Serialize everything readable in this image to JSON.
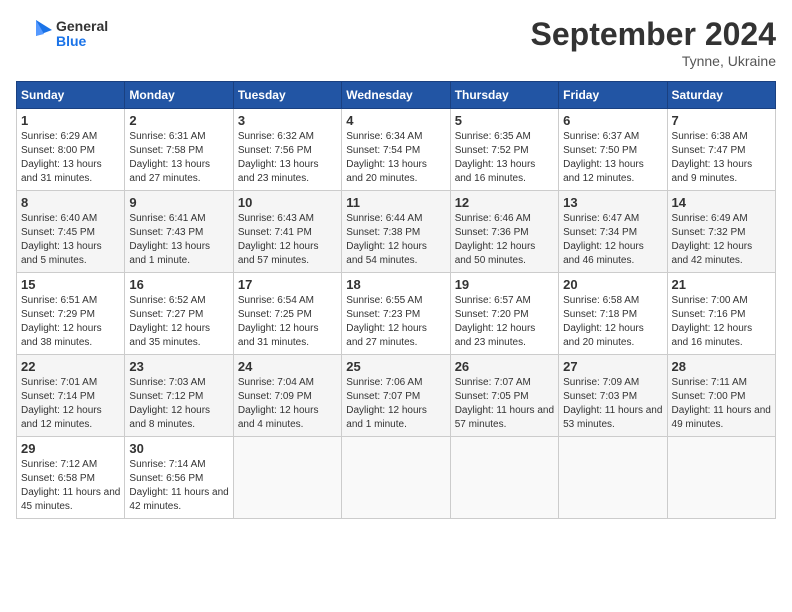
{
  "header": {
    "logo_line1": "General",
    "logo_line2": "Blue",
    "month_title": "September 2024",
    "location": "Tynne, Ukraine"
  },
  "weekdays": [
    "Sunday",
    "Monday",
    "Tuesday",
    "Wednesday",
    "Thursday",
    "Friday",
    "Saturday"
  ],
  "weeks": [
    [
      {
        "day": "1",
        "info": "Sunrise: 6:29 AM\nSunset: 8:00 PM\nDaylight: 13 hours and 31 minutes."
      },
      {
        "day": "2",
        "info": "Sunrise: 6:31 AM\nSunset: 7:58 PM\nDaylight: 13 hours and 27 minutes."
      },
      {
        "day": "3",
        "info": "Sunrise: 6:32 AM\nSunset: 7:56 PM\nDaylight: 13 hours and 23 minutes."
      },
      {
        "day": "4",
        "info": "Sunrise: 6:34 AM\nSunset: 7:54 PM\nDaylight: 13 hours and 20 minutes."
      },
      {
        "day": "5",
        "info": "Sunrise: 6:35 AM\nSunset: 7:52 PM\nDaylight: 13 hours and 16 minutes."
      },
      {
        "day": "6",
        "info": "Sunrise: 6:37 AM\nSunset: 7:50 PM\nDaylight: 13 hours and 12 minutes."
      },
      {
        "day": "7",
        "info": "Sunrise: 6:38 AM\nSunset: 7:47 PM\nDaylight: 13 hours and 9 minutes."
      }
    ],
    [
      {
        "day": "8",
        "info": "Sunrise: 6:40 AM\nSunset: 7:45 PM\nDaylight: 13 hours and 5 minutes."
      },
      {
        "day": "9",
        "info": "Sunrise: 6:41 AM\nSunset: 7:43 PM\nDaylight: 13 hours and 1 minute."
      },
      {
        "day": "10",
        "info": "Sunrise: 6:43 AM\nSunset: 7:41 PM\nDaylight: 12 hours and 57 minutes."
      },
      {
        "day": "11",
        "info": "Sunrise: 6:44 AM\nSunset: 7:38 PM\nDaylight: 12 hours and 54 minutes."
      },
      {
        "day": "12",
        "info": "Sunrise: 6:46 AM\nSunset: 7:36 PM\nDaylight: 12 hours and 50 minutes."
      },
      {
        "day": "13",
        "info": "Sunrise: 6:47 AM\nSunset: 7:34 PM\nDaylight: 12 hours and 46 minutes."
      },
      {
        "day": "14",
        "info": "Sunrise: 6:49 AM\nSunset: 7:32 PM\nDaylight: 12 hours and 42 minutes."
      }
    ],
    [
      {
        "day": "15",
        "info": "Sunrise: 6:51 AM\nSunset: 7:29 PM\nDaylight: 12 hours and 38 minutes."
      },
      {
        "day": "16",
        "info": "Sunrise: 6:52 AM\nSunset: 7:27 PM\nDaylight: 12 hours and 35 minutes."
      },
      {
        "day": "17",
        "info": "Sunrise: 6:54 AM\nSunset: 7:25 PM\nDaylight: 12 hours and 31 minutes."
      },
      {
        "day": "18",
        "info": "Sunrise: 6:55 AM\nSunset: 7:23 PM\nDaylight: 12 hours and 27 minutes."
      },
      {
        "day": "19",
        "info": "Sunrise: 6:57 AM\nSunset: 7:20 PM\nDaylight: 12 hours and 23 minutes."
      },
      {
        "day": "20",
        "info": "Sunrise: 6:58 AM\nSunset: 7:18 PM\nDaylight: 12 hours and 20 minutes."
      },
      {
        "day": "21",
        "info": "Sunrise: 7:00 AM\nSunset: 7:16 PM\nDaylight: 12 hours and 16 minutes."
      }
    ],
    [
      {
        "day": "22",
        "info": "Sunrise: 7:01 AM\nSunset: 7:14 PM\nDaylight: 12 hours and 12 minutes."
      },
      {
        "day": "23",
        "info": "Sunrise: 7:03 AM\nSunset: 7:12 PM\nDaylight: 12 hours and 8 minutes."
      },
      {
        "day": "24",
        "info": "Sunrise: 7:04 AM\nSunset: 7:09 PM\nDaylight: 12 hours and 4 minutes."
      },
      {
        "day": "25",
        "info": "Sunrise: 7:06 AM\nSunset: 7:07 PM\nDaylight: 12 hours and 1 minute."
      },
      {
        "day": "26",
        "info": "Sunrise: 7:07 AM\nSunset: 7:05 PM\nDaylight: 11 hours and 57 minutes."
      },
      {
        "day": "27",
        "info": "Sunrise: 7:09 AM\nSunset: 7:03 PM\nDaylight: 11 hours and 53 minutes."
      },
      {
        "day": "28",
        "info": "Sunrise: 7:11 AM\nSunset: 7:00 PM\nDaylight: 11 hours and 49 minutes."
      }
    ],
    [
      {
        "day": "29",
        "info": "Sunrise: 7:12 AM\nSunset: 6:58 PM\nDaylight: 11 hours and 45 minutes."
      },
      {
        "day": "30",
        "info": "Sunrise: 7:14 AM\nSunset: 6:56 PM\nDaylight: 11 hours and 42 minutes."
      },
      {
        "day": "",
        "info": ""
      },
      {
        "day": "",
        "info": ""
      },
      {
        "day": "",
        "info": ""
      },
      {
        "day": "",
        "info": ""
      },
      {
        "day": "",
        "info": ""
      }
    ]
  ]
}
